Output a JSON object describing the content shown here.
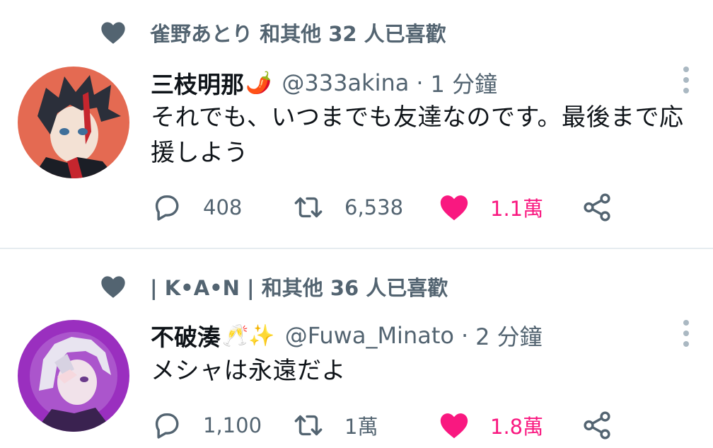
{
  "colors": {
    "secondary_text": "#536471",
    "like_pink": "#f91880",
    "primary_text": "#0f1419",
    "divider": "#e6ecf0"
  },
  "tweets": [
    {
      "like_context": "雀野あとり 和其他 32 人已喜歡",
      "display_name": "三枝明那",
      "name_emoji": "🌶️",
      "handle": "@333akina",
      "separator": "·",
      "time": "1 分鐘",
      "text": "それでも、いつまでも友達なのです。最後まで応援しよう",
      "reply_count": "408",
      "retweet_count": "6,538",
      "like_count": "1.1萬",
      "avatar_icon": "avatar-red-haired-illustration"
    },
    {
      "like_context": "| K•A•N | 和其他 36 人已喜歡",
      "display_name": "不破湊",
      "name_emoji": "🥂✨",
      "handle": "@Fuwa_Minato",
      "separator": "·",
      "time": "2 分鐘",
      "text": "メシャは永遠だよ",
      "reply_count": "1,100",
      "retweet_count": "1萬",
      "like_count": "1.8萬",
      "avatar_icon": "avatar-white-haired-illustration"
    }
  ]
}
